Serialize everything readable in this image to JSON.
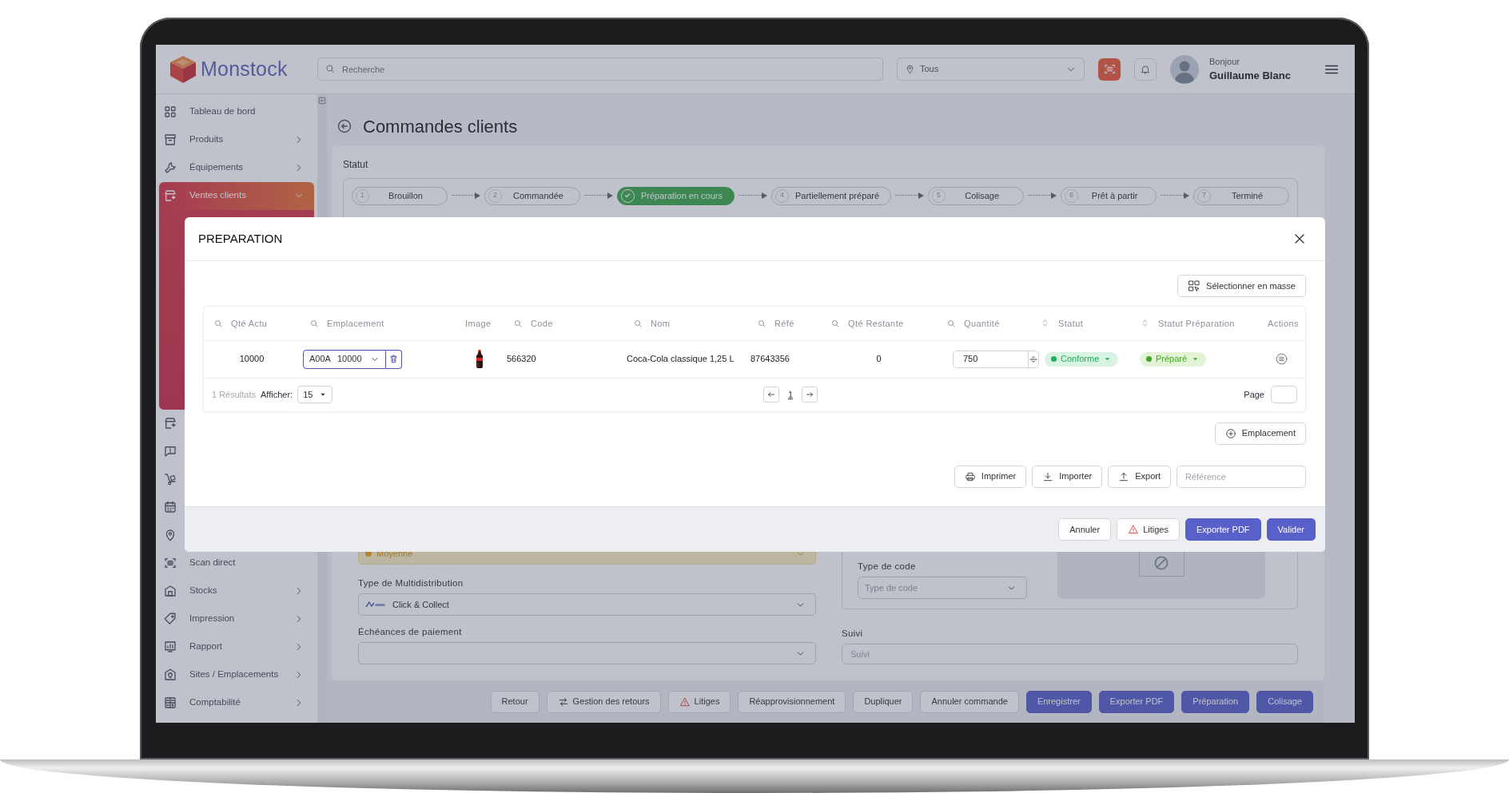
{
  "header": {
    "logo": "Monstock",
    "search": {
      "placeholder": "Recherche"
    },
    "site_filter": {
      "value": "Tous"
    },
    "greeting": "Bonjour",
    "user_name": "Guillaume Blanc"
  },
  "sidebar": {
    "items": [
      {
        "kind": "link",
        "label": "Tableau de bord",
        "selected": false
      },
      {
        "kind": "menu",
        "label": "Produits",
        "selected": false,
        "expanded": false
      },
      {
        "kind": "menu",
        "label": "Équipements",
        "selected": false,
        "expanded": false
      },
      {
        "kind": "menu",
        "label": "Ventes clients",
        "selected": true,
        "expanded": true
      },
      {
        "kind": "icon_only",
        "selected": false
      },
      {
        "kind": "icon_only",
        "selected": false
      },
      {
        "kind": "icon_only",
        "selected": false
      },
      {
        "kind": "icon_only",
        "selected": false
      },
      {
        "kind": "icon_only",
        "selected": false
      },
      {
        "kind": "link",
        "label": "Scan direct",
        "selected": false
      },
      {
        "kind": "menu",
        "label": "Stocks",
        "selected": false,
        "expanded": false
      },
      {
        "kind": "menu",
        "label": "Impression",
        "selected": false,
        "expanded": false
      },
      {
        "kind": "menu",
        "label": "Rapport",
        "selected": false,
        "expanded": false
      },
      {
        "kind": "menu",
        "label": "Sites / Emplacements",
        "selected": false,
        "expanded": false
      },
      {
        "kind": "menu",
        "label": "Comptabilité",
        "selected": false,
        "expanded": false
      }
    ]
  },
  "page": {
    "title": "Commandes clients",
    "status": {
      "label": "Statut",
      "steps": [
        {
          "number": "1",
          "label": "Brouillon",
          "selected": false
        },
        {
          "number": "2",
          "label": "Commandée",
          "selected": false
        },
        {
          "label": "Préparation en cours",
          "selected": true
        },
        {
          "number": "4",
          "label": "Partiellement préparé",
          "selected": false
        },
        {
          "number": "5",
          "label": "Colisage",
          "selected": false
        },
        {
          "number": "6",
          "label": "Prêt à partir",
          "selected": false
        },
        {
          "number": "7",
          "label": "Terminé",
          "selected": false
        }
      ]
    },
    "form": {
      "priority": {
        "value": "Moyenne"
      },
      "multidistribution": {
        "label": "Type de Multidistribution",
        "value": "Click & Collect"
      },
      "payment_terms": {
        "label": "Échéances de paiement"
      },
      "code_type": {
        "label": "Type de code",
        "placeholder": "Type de code"
      },
      "tracking": {
        "label": "Suivi",
        "placeholder": "Suivi"
      }
    }
  },
  "action_bar": {
    "buttons": [
      {
        "label": "Retour",
        "kind": "light"
      },
      {
        "label": "Gestion des retours",
        "kind": "light"
      },
      {
        "label": "Litiges",
        "kind": "light"
      },
      {
        "label": "Réapprovisionnement",
        "kind": "light"
      },
      {
        "label": "Dupliquer",
        "kind": "light"
      },
      {
        "label": "Annuler commande",
        "kind": "light"
      },
      {
        "label": "Enregistrer",
        "kind": "primary"
      },
      {
        "label": "Exporter PDF",
        "kind": "primary"
      },
      {
        "label": "Préparation",
        "kind": "primary"
      },
      {
        "label": "Colisage",
        "kind": "primary"
      }
    ]
  },
  "modal": {
    "title": "PREPARATION",
    "mass_select_button": "Sélectionner en masse",
    "table": {
      "columns": [
        {
          "label": "Qté Actu",
          "kind": "search"
        },
        {
          "label": "Emplacement",
          "kind": "search"
        },
        {
          "label": "Image",
          "kind": "plain"
        },
        {
          "label": "Code",
          "kind": "search"
        },
        {
          "label": "Nom",
          "kind": "search"
        },
        {
          "label": "Réfé",
          "kind": "search"
        },
        {
          "label": "Qté Restante",
          "kind": "search"
        },
        {
          "label": "Quantité",
          "kind": "search"
        },
        {
          "label": "Statut",
          "kind": "sort"
        },
        {
          "label": "Statut Préparation",
          "kind": "sort"
        },
        {
          "label": "Actions",
          "kind": "plain"
        }
      ],
      "rows": [
        {
          "qte_actuelle": "10000",
          "emplacement": {
            "code": "A00A",
            "quantity": "10000"
          },
          "code": "566320",
          "nom": "Coca-Cola classique 1,25 L",
          "reference": "87643356",
          "qte_restante": "0",
          "quantite": "750",
          "statut": "Conforme",
          "statut_preparation": "Préparé"
        }
      ],
      "footer": {
        "results": "1 Résultats",
        "show_label": "Afficher:",
        "page_size": "15",
        "current_page": "1",
        "page_label": "Page"
      }
    },
    "location_button": "Emplacement",
    "tools": [
      {
        "label": "Imprimer"
      },
      {
        "label": "Importer"
      },
      {
        "label": "Export"
      }
    ],
    "reference_field": {
      "placeholder": "Référence"
    },
    "footer_buttons": [
      {
        "label": "Annuler",
        "kind": "light"
      },
      {
        "label": "Litiges",
        "kind": "light"
      },
      {
        "label": "Exporter PDF",
        "kind": "primary"
      },
      {
        "label": "Valider",
        "kind": "primary"
      }
    ]
  }
}
